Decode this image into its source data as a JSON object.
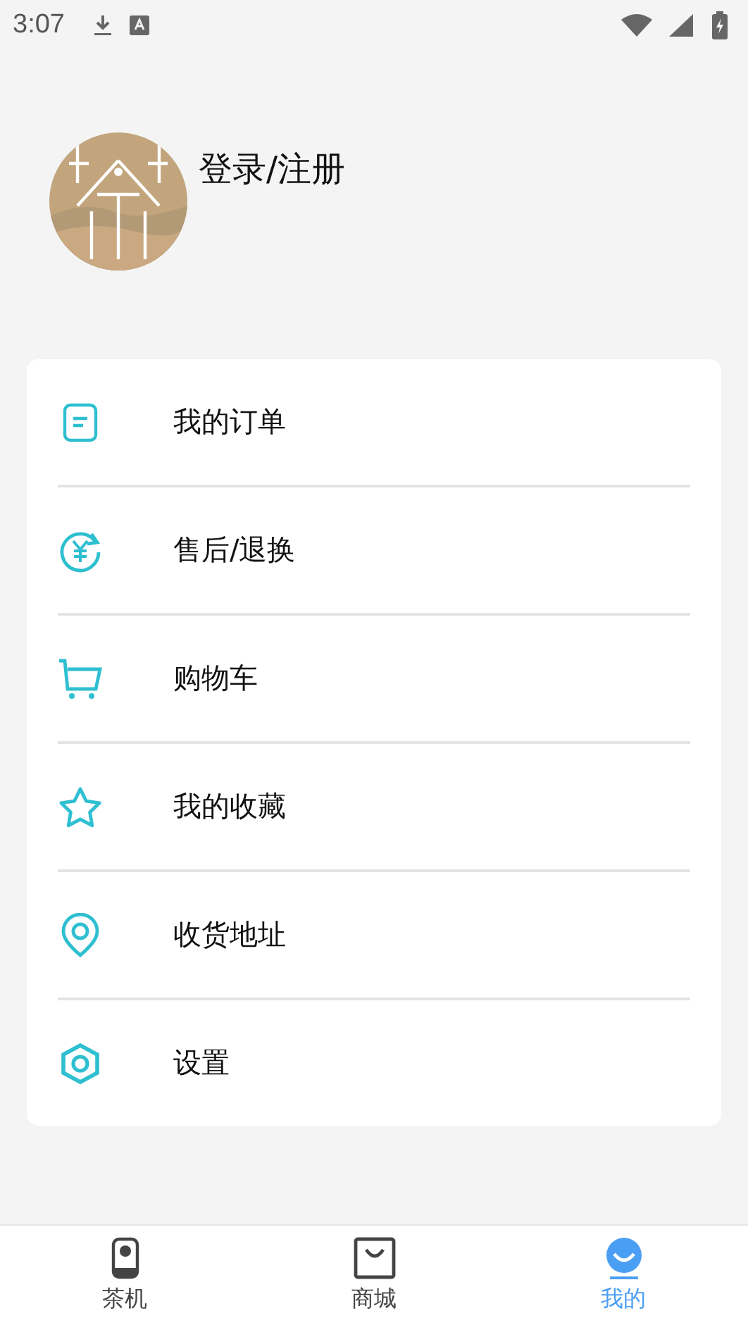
{
  "status_bar": {
    "time": "3:07"
  },
  "profile": {
    "login_label": "登录/注册"
  },
  "menu": [
    {
      "label": "我的订单"
    },
    {
      "label": "售后/退换"
    },
    {
      "label": "购物车"
    },
    {
      "label": "我的收藏"
    },
    {
      "label": "收货地址"
    },
    {
      "label": "设置"
    }
  ],
  "bottom_nav": [
    {
      "label": "茶机",
      "selected": false
    },
    {
      "label": "商城",
      "selected": false
    },
    {
      "label": "我的",
      "selected": true
    }
  ]
}
